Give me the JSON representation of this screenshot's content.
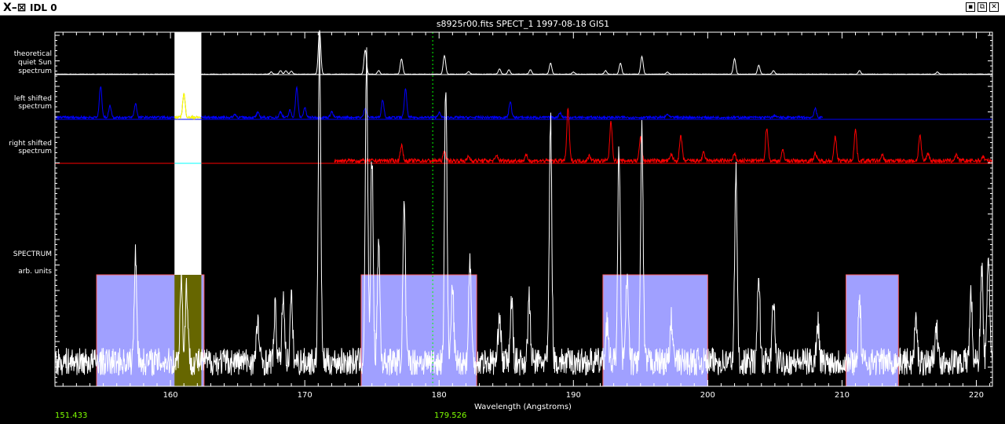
{
  "window": {
    "title": "IDL 0",
    "icon": "x-logo-icon",
    "controls": [
      "minimize-icon",
      "maximize-icon",
      "close-icon"
    ]
  },
  "plot": {
    "title": "s8925r00.fits SPECT_1 1997-08-18 GIS1",
    "xlabel": "Wavelength (Angstroms)",
    "cursor_left_readout": "151.433",
    "cursor_right_readout": "179.526",
    "panel_labels": {
      "theoretical": [
        "theoretical",
        "quiet Sun",
        "spectrum"
      ],
      "left": [
        "left shifted",
        "spectrum"
      ],
      "right": [
        "right shifted",
        "spectrum"
      ],
      "spectrum": [
        "SPECTRUM",
        "arb. units"
      ]
    }
  },
  "chart_data": {
    "type": "line",
    "title": "s8925r00.fits SPECT_1 1997-08-18 GIS1",
    "xlabel": "Wavelength (Angstroms)",
    "ylabel": "SPECTRUM arb. units",
    "xlim": [
      151.4,
      221.2
    ],
    "x_ticks": [
      160,
      170,
      180,
      190,
      200,
      210,
      220
    ],
    "cursor_x": 179.526,
    "selected_band": [
      160.3,
      162.3
    ],
    "windows": [
      [
        154.5,
        162.5
      ],
      [
        174.2,
        182.8
      ],
      [
        192.2,
        200.0
      ],
      [
        210.3,
        214.2
      ]
    ],
    "colors": {
      "theoretical": "#ffffff",
      "left_shifted": "#0000ff",
      "right_shifted": "#ff0000",
      "spectrum": "#ffffff",
      "window_fill": "#a0a0ff",
      "selected_fill": "#666600",
      "selected_line": "#ffff00",
      "cursor": "#00ff00"
    },
    "series": [
      {
        "name": "theoretical quiet Sun spectrum",
        "range": [
          151.4,
          221.2
        ],
        "lines": [
          [
            167.5,
            0.05
          ],
          [
            168.2,
            0.08
          ],
          [
            168.6,
            0.08
          ],
          [
            169.0,
            0.07
          ],
          [
            171.1,
            1.0
          ],
          [
            174.5,
            0.55
          ],
          [
            175.5,
            0.08
          ],
          [
            177.2,
            0.35
          ],
          [
            180.4,
            0.42
          ],
          [
            182.2,
            0.06
          ],
          [
            184.5,
            0.12
          ],
          [
            185.2,
            0.1
          ],
          [
            186.8,
            0.1
          ],
          [
            188.3,
            0.25
          ],
          [
            190.0,
            0.05
          ],
          [
            192.4,
            0.08
          ],
          [
            193.5,
            0.25
          ],
          [
            195.1,
            0.4
          ],
          [
            197.0,
            0.05
          ],
          [
            202.0,
            0.35
          ],
          [
            203.8,
            0.2
          ],
          [
            204.9,
            0.08
          ],
          [
            211.3,
            0.08
          ],
          [
            217.1,
            0.05
          ]
        ],
        "base": 0.01,
        "noise": 0.005
      },
      {
        "name": "left shifted spectrum",
        "range": [
          151.4,
          208.6
        ],
        "lines": [
          [
            154.8,
            0.8
          ],
          [
            155.5,
            0.3
          ],
          [
            157.4,
            0.35
          ],
          [
            161.0,
            0.6
          ],
          [
            164.8,
            0.08
          ],
          [
            166.5,
            0.12
          ],
          [
            168.2,
            0.15
          ],
          [
            168.9,
            0.18
          ],
          [
            169.4,
            0.75
          ],
          [
            170.0,
            0.25
          ],
          [
            172.0,
            0.15
          ],
          [
            174.5,
            0.25
          ],
          [
            175.8,
            0.45
          ],
          [
            177.5,
            0.72
          ],
          [
            180.0,
            0.12
          ],
          [
            185.3,
            0.4
          ],
          [
            189.0,
            0.12
          ],
          [
            197.0,
            0.08
          ],
          [
            205.0,
            0.05
          ],
          [
            208.0,
            0.22
          ]
        ],
        "base": 0.05,
        "noise": 0.03
      },
      {
        "name": "right shifted spectrum",
        "range": [
          172.2,
          221.2
        ],
        "lines": [
          [
            177.2,
            0.3
          ],
          [
            180.4,
            0.18
          ],
          [
            182.2,
            0.08
          ],
          [
            184.3,
            0.1
          ],
          [
            186.5,
            0.1
          ],
          [
            189.6,
            1.0
          ],
          [
            191.2,
            0.1
          ],
          [
            192.8,
            0.75
          ],
          [
            195.0,
            0.45
          ],
          [
            197.3,
            0.12
          ],
          [
            198.0,
            0.48
          ],
          [
            199.7,
            0.15
          ],
          [
            202.0,
            0.12
          ],
          [
            204.4,
            0.65
          ],
          [
            205.6,
            0.2
          ],
          [
            208.0,
            0.15
          ],
          [
            209.5,
            0.45
          ],
          [
            211.0,
            0.6
          ],
          [
            213.0,
            0.1
          ],
          [
            215.8,
            0.5
          ],
          [
            216.4,
            0.15
          ],
          [
            218.5,
            0.12
          ],
          [
            220.5,
            0.08
          ]
        ],
        "base": 0.05,
        "noise": 0.04
      },
      {
        "name": "SPECTRUM",
        "range": [
          151.4,
          221.2
        ],
        "lines": [
          [
            157.4,
            0.32
          ],
          [
            160.8,
            0.25
          ],
          [
            161.2,
            0.22
          ],
          [
            166.5,
            0.12
          ],
          [
            167.8,
            0.15
          ],
          [
            168.4,
            0.2
          ],
          [
            169.0,
            0.18
          ],
          [
            171.1,
            0.92
          ],
          [
            174.6,
            0.88
          ],
          [
            175.0,
            0.6
          ],
          [
            175.5,
            0.35
          ],
          [
            177.4,
            0.45
          ],
          [
            180.5,
            0.82
          ],
          [
            181.0,
            0.22
          ],
          [
            182.3,
            0.3
          ],
          [
            184.5,
            0.15
          ],
          [
            185.4,
            0.18
          ],
          [
            186.7,
            0.18
          ],
          [
            188.3,
            0.7
          ],
          [
            192.5,
            0.12
          ],
          [
            193.4,
            0.62
          ],
          [
            194.0,
            0.25
          ],
          [
            195.1,
            0.67
          ],
          [
            197.3,
            0.12
          ],
          [
            202.1,
            0.55
          ],
          [
            203.8,
            0.25
          ],
          [
            204.9,
            0.18
          ],
          [
            208.2,
            0.12
          ],
          [
            211.3,
            0.18
          ],
          [
            215.5,
            0.12
          ],
          [
            217.0,
            0.12
          ],
          [
            219.6,
            0.2
          ],
          [
            220.4,
            0.28
          ],
          [
            220.9,
            0.32
          ]
        ],
        "base": 0.06,
        "noise": 0.04
      }
    ]
  }
}
